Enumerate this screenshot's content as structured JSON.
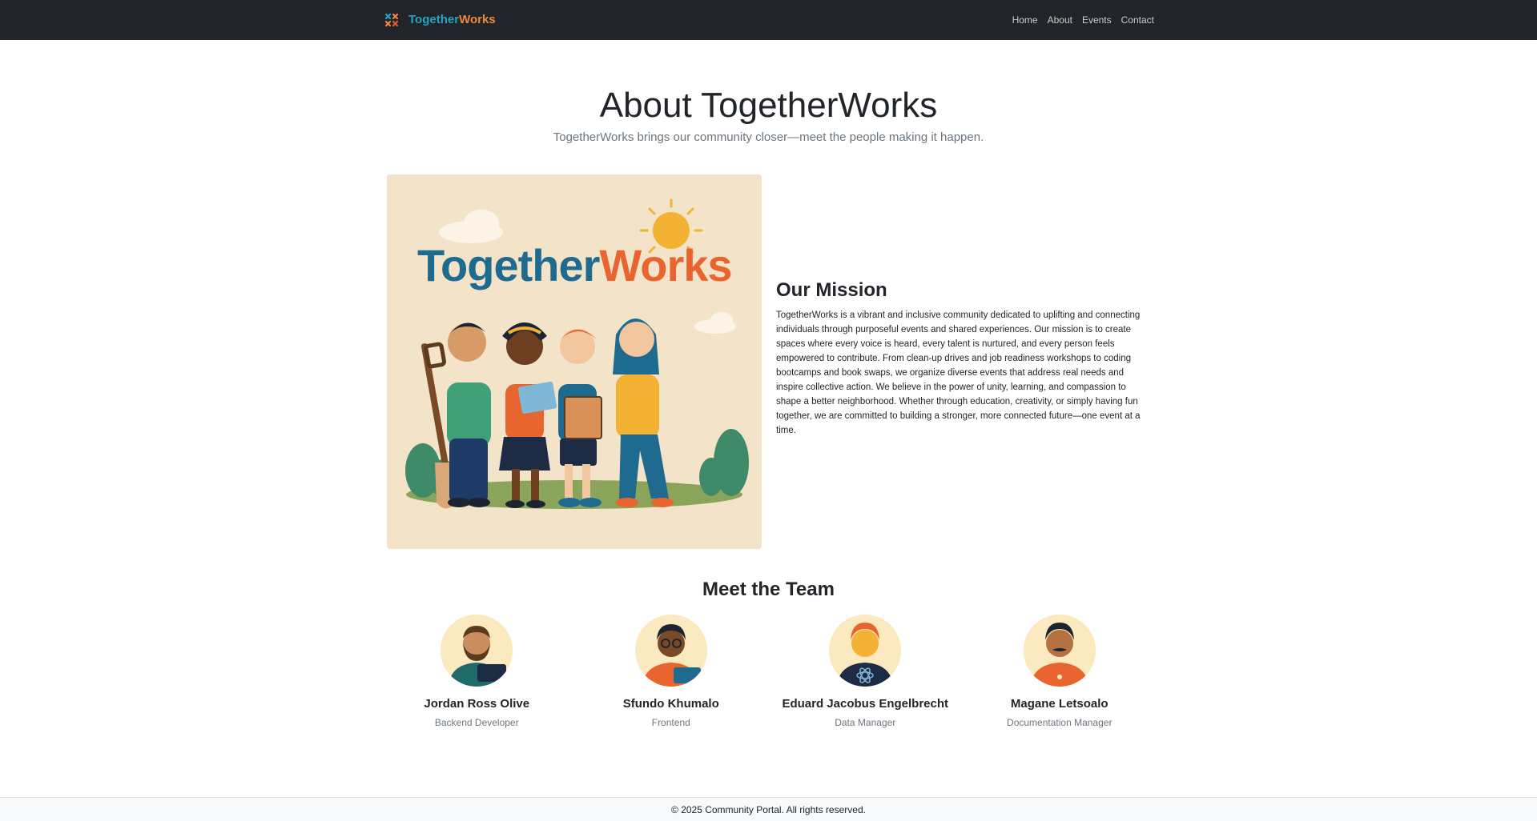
{
  "brand": {
    "name_part1": "Together",
    "name_part2": "Works",
    "logo_icon": "grid-x-logo-icon",
    "color_part1": "#2aa3c6",
    "color_part2": "#f08a3b"
  },
  "nav": {
    "links": [
      "Home",
      "About",
      "Events",
      "Contact"
    ]
  },
  "header": {
    "title": "About TogetherWorks",
    "lead": "TogetherWorks brings our community closer—meet the people making it happen."
  },
  "hero": {
    "image_title_part1": "Together",
    "image_title_part2": "Works",
    "image_icon": "community-volunteers-illustration"
  },
  "mission": {
    "title": "Our Mission",
    "text": "TogetherWorks is a vibrant and inclusive community dedicated to uplifting and connecting individuals through purposeful events and shared experiences. Our mission is to create spaces where every voice is heard, every talent is nurtured, and every person feels empowered to contribute. From clean-up drives and job readiness workshops to coding bootcamps and book swaps, we organize diverse events that address real needs and inspire collective action. We believe in the power of unity, learning, and compassion to shape a better neighborhood. Whether through education, creativity, or simply having fun together, we are committed to building a stronger, more connected future—one event at a time."
  },
  "team": {
    "title": "Meet the Team",
    "members": [
      {
        "name": "Jordan Ross Olive",
        "role": "Backend Developer",
        "avatar": "bearded-man-laptop-avatar"
      },
      {
        "name": "Sfundo Khumalo",
        "role": "Frontend",
        "avatar": "glasses-man-laptop-avatar"
      },
      {
        "name": "Eduard Jacobus Engelbrecht",
        "role": "Data Manager",
        "avatar": "redhead-man-react-shirt-avatar"
      },
      {
        "name": "Magane Letsoalo",
        "role": "Documentation Manager",
        "avatar": "mustache-man-avatar"
      }
    ]
  },
  "footer": {
    "text": "© 2025 Community Portal. All rights reserved."
  },
  "colors": {
    "navbar_bg": "#212529",
    "hero_bg": "#f3e3c9",
    "text_muted": "#6c757d"
  }
}
